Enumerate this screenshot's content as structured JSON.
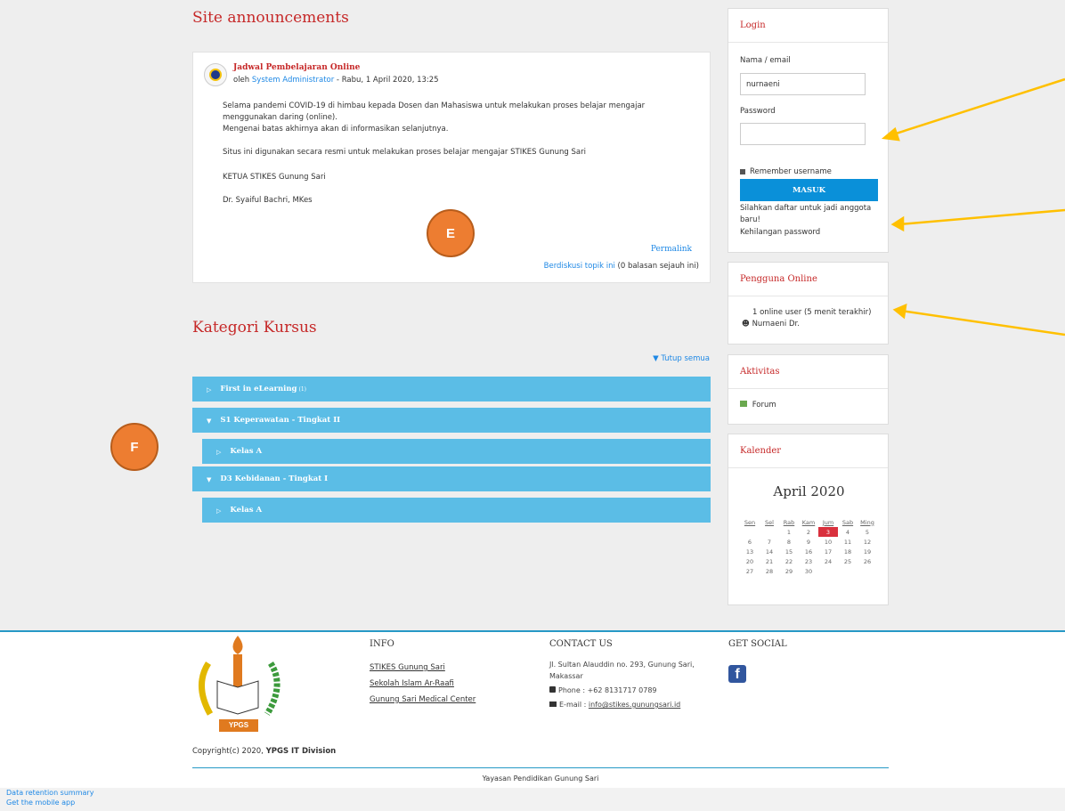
{
  "announcements": {
    "heading": "Site announcements",
    "post": {
      "title": "Jadwal Pembelajaran Online",
      "by_prefix": "oleh",
      "author": "System Administrator",
      "date": " - Rabu, 1 April 2020, 13:25",
      "lines": [
        "Selama pandemi COVID-19 di himbau kepada Dosen dan Mahasiswa untuk melakukan proses belajar mengajar",
        "menggunakan daring (online).",
        "Mengenai batas akhirnya akan di informasikan selanjutnya.",
        "Situs ini digunakan secara resmi untuk melakukan proses belajar mengajar STIKES Gunung Sari",
        "KETUA STIKES Gunung Sari",
        "Dr. Syaiful Bachri, MKes"
      ],
      "permalink": "Permalink",
      "discuss_link": "Berdiskusi topik ini",
      "discuss_count": "(0 balasan sejauh ini)"
    }
  },
  "markers": {
    "e": "E",
    "f": "F"
  },
  "categories": {
    "heading": "Kategori Kursus",
    "collapse_all": "Tutup semua",
    "items": [
      {
        "label": "First in eLearning",
        "count": "(1)"
      },
      {
        "label": "S1 Keperawatan - Tingkat II"
      },
      {
        "label": "Kelas A"
      },
      {
        "label": "D3 Kebidanan - Tingkat I"
      },
      {
        "label": "Kelas A"
      }
    ]
  },
  "login": {
    "heading": "Login",
    "username_label": "Nama / email",
    "username_value": "nurnaeni",
    "password_label": "Password",
    "password_value": "",
    "remember_label": "Remember username",
    "button": "MASUK",
    "signup_line1": "Silahkan daftar untuk jadi anggota",
    "signup_line2": "baru!",
    "forgot": "Kehilangan password"
  },
  "online": {
    "heading": "Pengguna Online",
    "summary": "1 online user (5 menit terakhir)",
    "user": "Nurnaeni Dr."
  },
  "activity": {
    "heading": "Aktivitas",
    "forum": "Forum"
  },
  "calendar": {
    "heading": "Kalender",
    "month": "April 2020",
    "days": [
      "Sen",
      "Sel",
      "Rab",
      "Kam",
      "Jum",
      "Sab",
      "Ming"
    ],
    "today": "3",
    "weeks": [
      [
        "",
        "",
        "1",
        "2",
        "3",
        "4",
        "5"
      ],
      [
        "6",
        "7",
        "8",
        "9",
        "10",
        "11",
        "12"
      ],
      [
        "13",
        "14",
        "15",
        "16",
        "17",
        "18",
        "19"
      ],
      [
        "20",
        "21",
        "22",
        "23",
        "24",
        "25",
        "26"
      ],
      [
        "27",
        "28",
        "29",
        "30",
        "",
        "",
        ""
      ]
    ]
  },
  "footer": {
    "logo_text": "YPGS",
    "info_heading": "INFO",
    "info_links": [
      "STIKES Gunung Sari",
      "Sekolah Islam Ar-Raafi",
      "Gunung Sari Medical Center"
    ],
    "contact_heading": "CONTACT US",
    "address_line1": "Jl. Sultan Alauddin no. 293, Gunung Sari,",
    "address_line2": "Makassar",
    "phone": "Phone : +62 8131717 0789",
    "email_prefix": "E-mail : ",
    "email": "info@stikes.gunungsari.id",
    "social_heading": "GET SOCIAL",
    "copyright_prefix": "Copyright(c) 2020,",
    "copyright_org": "YPGS IT Division",
    "org": "Yayasan Pendidikan Gunung Sari"
  },
  "bottom": {
    "retention": "Data retention summary",
    "mobile": "Get the mobile app"
  }
}
